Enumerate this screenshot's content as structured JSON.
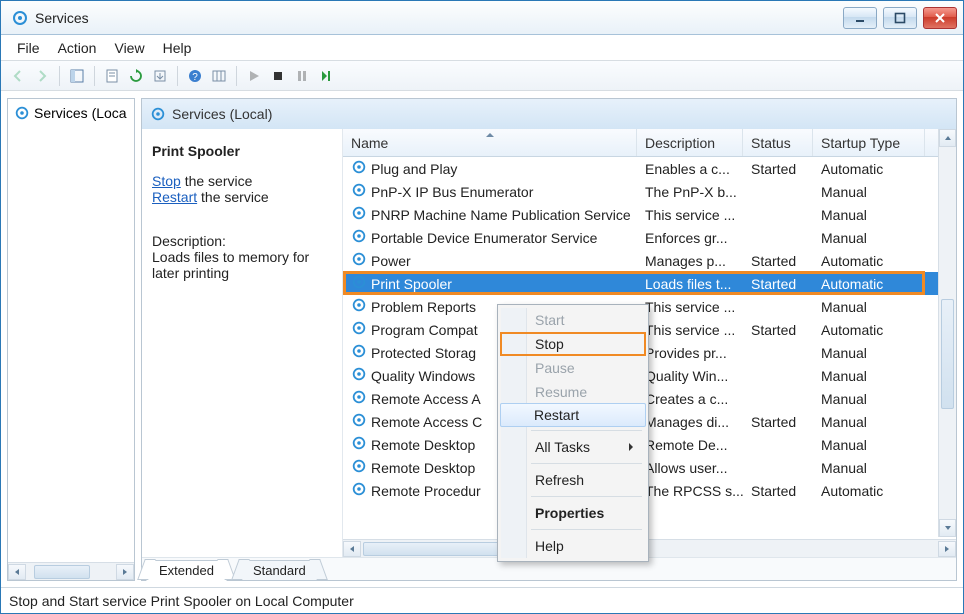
{
  "window": {
    "title": "Services"
  },
  "menu": {
    "file": "File",
    "action": "Action",
    "view": "View",
    "help": "Help"
  },
  "tree": {
    "root": "Services (Loca"
  },
  "header": {
    "title": "Services (Local)"
  },
  "details": {
    "selected_name": "Print Spooler",
    "stop_link": "Stop",
    "stop_suffix": " the service",
    "restart_link": "Restart",
    "restart_suffix": " the service",
    "desc_label": "Description:",
    "desc_text": "Loads files to memory for later printing"
  },
  "columns": {
    "name": "Name",
    "desc": "Description",
    "status": "Status",
    "startup": "Startup Type"
  },
  "tabs": {
    "extended": "Extended",
    "standard": "Standard"
  },
  "status_bar": "Stop and Start service Print Spooler on Local Computer",
  "context_menu": {
    "start": "Start",
    "stop": "Stop",
    "pause": "Pause",
    "resume": "Resume",
    "restart": "Restart",
    "all_tasks": "All Tasks",
    "refresh": "Refresh",
    "properties": "Properties",
    "help": "Help"
  },
  "services": [
    {
      "name": "Plug and Play",
      "desc": "Enables a c...",
      "status": "Started",
      "startup": "Automatic"
    },
    {
      "name": "PnP-X IP Bus Enumerator",
      "desc": "The PnP-X b...",
      "status": "",
      "startup": "Manual"
    },
    {
      "name": "PNRP Machine Name Publication Service",
      "desc": "This service ...",
      "status": "",
      "startup": "Manual"
    },
    {
      "name": "Portable Device Enumerator Service",
      "desc": "Enforces gr...",
      "status": "",
      "startup": "Manual"
    },
    {
      "name": "Power",
      "desc": "Manages p...",
      "status": "Started",
      "startup": "Automatic"
    },
    {
      "name": "Print Spooler",
      "desc": "Loads files t...",
      "status": "Started",
      "startup": "Automatic",
      "selected": true
    },
    {
      "name": "Problem Reports",
      "desc": "This service ...",
      "status": "",
      "startup": "Manual"
    },
    {
      "name": "Program Compat",
      "desc": "This service ...",
      "status": "Started",
      "startup": "Automatic"
    },
    {
      "name": "Protected Storag",
      "desc": "Provides pr...",
      "status": "",
      "startup": "Manual"
    },
    {
      "name": "Quality Windows",
      "desc": "Quality Win...",
      "status": "",
      "startup": "Manual"
    },
    {
      "name": "Remote Access A",
      "desc": "Creates a c...",
      "status": "",
      "startup": "Manual"
    },
    {
      "name": "Remote Access C",
      "desc": "Manages di...",
      "status": "Started",
      "startup": "Manual"
    },
    {
      "name": "Remote Desktop",
      "desc": "Remote De...",
      "status": "",
      "startup": "Manual"
    },
    {
      "name": "Remote Desktop",
      "desc": "Allows user...",
      "status": "",
      "startup": "Manual"
    },
    {
      "name": "Remote Procedur",
      "desc": "The RPCSS s...",
      "status": "Started",
      "startup": "Automatic"
    }
  ]
}
